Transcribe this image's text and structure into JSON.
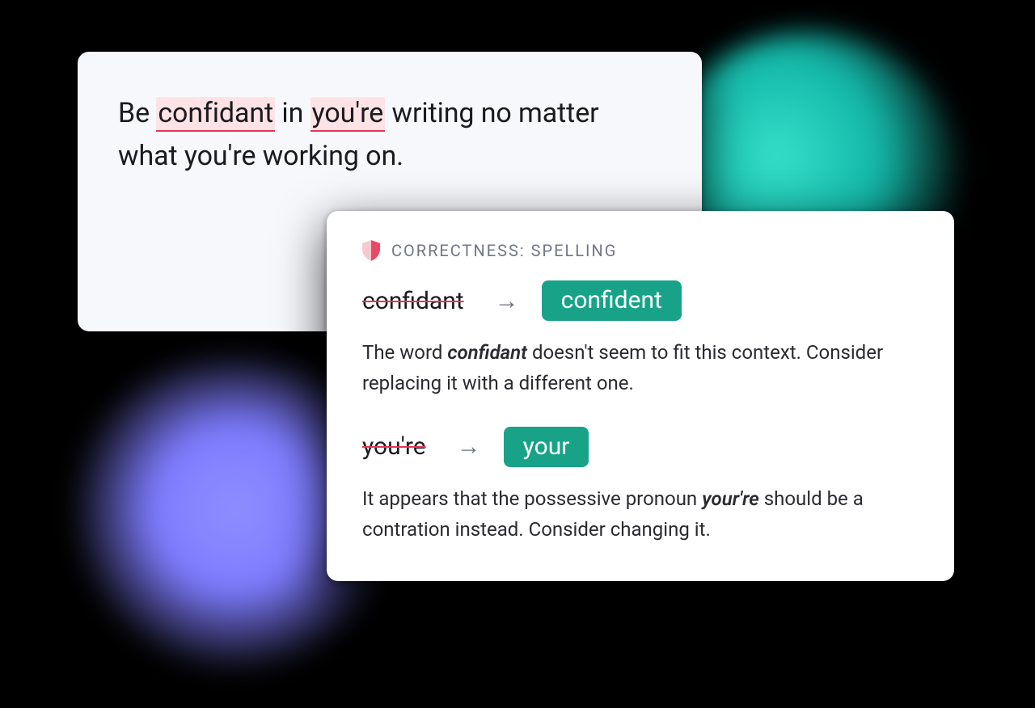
{
  "editor": {
    "prefix": "Be ",
    "error1": "confidant",
    "mid1": " in ",
    "error2": "you're",
    "rest": " writing no matter what you're working on."
  },
  "popup": {
    "category": "CORRECTNESS: SPELLING",
    "suggestions": [
      {
        "old": "confidant",
        "new": "confident",
        "explain_pre": "The word ",
        "explain_em": "confidant",
        "explain_post": " doesn't seem to fit this context. Consider replacing it with a different one."
      },
      {
        "old": "you're",
        "new": "your",
        "explain_pre": "It appears that the possessive pronoun ",
        "explain_em": "your're",
        "explain_post": " should be a contration instead. Consider changing it."
      }
    ]
  },
  "colors": {
    "error_underline": "#e63757",
    "suggestion_bg": "#18a389",
    "halo_teal": "#34e0c9",
    "halo_purple": "#8f8dff"
  }
}
